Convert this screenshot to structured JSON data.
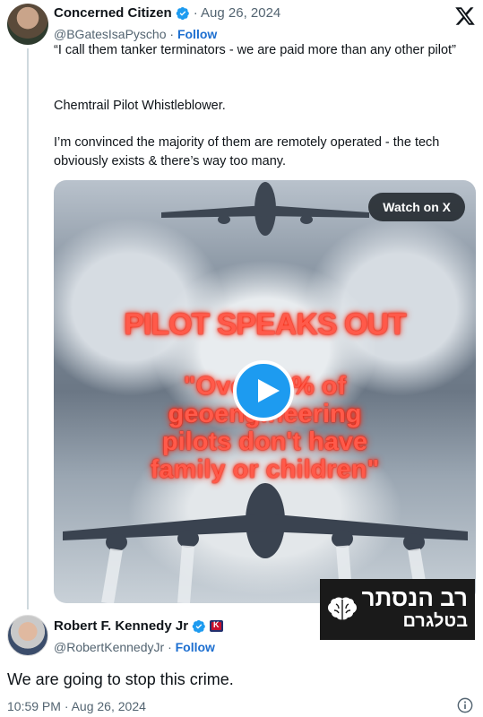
{
  "original_tweet": {
    "display_name": "Concerned Citizen",
    "date": "· Aug 26, 2024",
    "handle": "@BGatesIsaPyscho",
    "separator": "·",
    "follow_label": "Follow",
    "paragraphs": [
      "“I call them tanker terminators - we are paid more than any other pilot”",
      "Chemtrail Pilot Whistleblower.",
      "I’m convinced the majority of them are remotely operated - the tech obviously exists & there’s way too many."
    ],
    "media": {
      "watch_label": "Watch on X",
      "overlay_title": "PILOT SPEAKS OUT",
      "overlay_lines": [
        "\"Over 90% of",
        "geoengineering",
        "pilots don't have",
        "family or children\""
      ]
    }
  },
  "channel_badge": {
    "line1": "רב הנסתר",
    "line2": "בטלגרם"
  },
  "reply_tweet": {
    "display_name": "Robert F. Kennedy Jr",
    "handle": "@RobertKennedyJr",
    "separator": "·",
    "follow_label": "Follow",
    "text": "We are going to stop this crime.",
    "timestamp": "10:59 PM · Aug 26, 2024"
  },
  "colors": {
    "accent": "#1d9bf0",
    "follow": "#1d6fd0",
    "overlay_text": "#ff5a4a"
  },
  "icons": [
    "x-logo-icon",
    "verified-badge-icon",
    "play-icon",
    "brain-icon",
    "info-icon",
    "campaign-flag-icon"
  ]
}
